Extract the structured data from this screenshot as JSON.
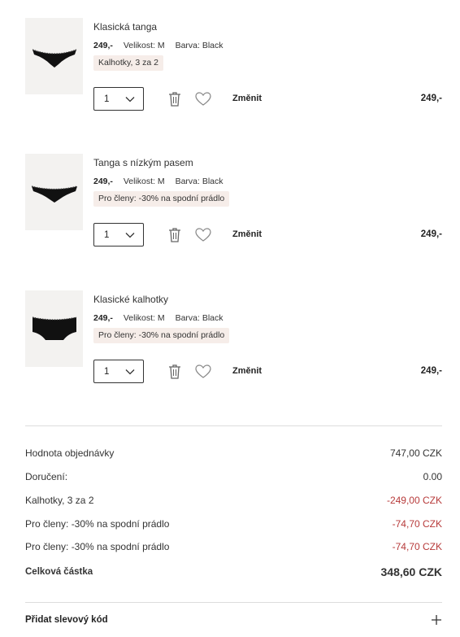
{
  "items": [
    {
      "name": "Klasická tanga",
      "price": "249,-",
      "size_label": "Velikost: M",
      "color_label": "Barva: Black",
      "promo": "Kalhotky, 3 za 2",
      "qty": "1",
      "change_label": "Změnit",
      "line_total": "249,-",
      "image_icon": "thong-icon"
    },
    {
      "name": "Tanga s nízkým pasem",
      "price": "249,-",
      "size_label": "Velikost: M",
      "color_label": "Barva: Black",
      "promo": "Pro členy: -30% na spodní prádlo",
      "qty": "1",
      "change_label": "Změnit",
      "line_total": "249,-",
      "image_icon": "lowrise-thong-icon"
    },
    {
      "name": "Klasické kalhotky",
      "price": "249,-",
      "size_label": "Velikost: M",
      "color_label": "Barva: Black",
      "promo": "Pro členy: -30% na spodní prádlo",
      "qty": "1",
      "change_label": "Změnit",
      "line_total": "249,-",
      "image_icon": "brief-icon"
    }
  ],
  "summary": {
    "order_value_label": "Hodnota objednávky",
    "order_value": "747,00 CZK",
    "delivery_label": "Doručení:",
    "delivery_value": "0.00",
    "discount1_label": "Kalhotky, 3 za 2",
    "discount1_value": "-249,00 CZK",
    "discount2_label": "Pro členy: -30% na spodní prádlo",
    "discount2_value": "-74,70 CZK",
    "discount3_label": "Pro členy: -30% na spodní prádlo",
    "discount3_value": "-74,70 CZK",
    "total_label": "Celková částka",
    "total_value": "348,60 CZK"
  },
  "coupon": {
    "label": "Přidat slevový kód"
  },
  "colors": {
    "promo_bg": "#f6ede9",
    "discount_text": "#b73a3a",
    "divider": "#dddddd"
  }
}
